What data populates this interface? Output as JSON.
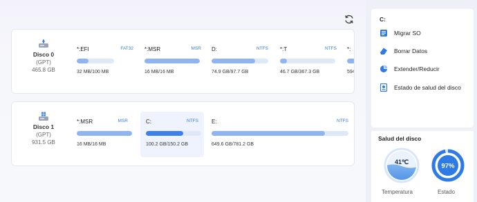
{
  "main": {
    "refresh_icon": "refresh-icon",
    "disks": [
      {
        "name": "Disco 0",
        "type": "(GPT)",
        "size": "465.8 GB",
        "icon": "drive-icon",
        "partitions": [
          {
            "label": "*:EFI",
            "fs": "FAT32",
            "size": "32 MB/100 MB",
            "used_fraction": 0.32
          },
          {
            "label": "*:MSR",
            "fs": "MSR",
            "size": "16 MB/16 MB",
            "used_fraction": 1.0
          },
          {
            "label": "D:",
            "fs": "NTFS",
            "size": "74.9 GB/97.7 GB",
            "used_fraction": 0.77
          },
          {
            "label": "*:T",
            "fs": "NTFS",
            "size": "46.7 GB/367.3 GB",
            "used_fraction": 0.13
          },
          {
            "label": "*:",
            "fs": "",
            "size": "594",
            "used_fraction": 0.5
          }
        ]
      },
      {
        "name": "Disco 1",
        "type": "(GPT)",
        "size": "931.5 GB",
        "icon": "windows-drive-icon",
        "partitions": [
          {
            "label": "*:MSR",
            "fs": "MSR",
            "size": "16 MB/16 MB",
            "used_fraction": 1.0
          },
          {
            "label": "C:",
            "fs": "NTFS",
            "size": "100.2 GB/150.2 GB",
            "used_fraction": 0.67,
            "selected": true
          },
          {
            "label": "E:",
            "fs": "NTFS",
            "size": "649.6 GB/781.2 GB",
            "used_fraction": 0.83
          }
        ]
      }
    ]
  },
  "sidebar": {
    "title": "C:",
    "items": [
      {
        "label": "Migrar SO",
        "icon": "migrate-os-icon"
      },
      {
        "label": "Borrar Datos",
        "icon": "eraser-icon"
      },
      {
        "label": "Extender/Reducir",
        "icon": "pie-resize-icon"
      },
      {
        "label": "Estado de salud del disco",
        "icon": "disk-health-icon"
      }
    ]
  },
  "health": {
    "title": "Salud del disco",
    "temperature": {
      "value": "41℃",
      "label": "Temperatura"
    },
    "state": {
      "value": "97%",
      "label": "Estado",
      "percent": 97
    }
  },
  "colors": {
    "accent": "#2f7be6",
    "bar_fill": "#8fb4ef",
    "bar_selected": "#3f7fe8",
    "bar_track": "#dfe8f7"
  }
}
